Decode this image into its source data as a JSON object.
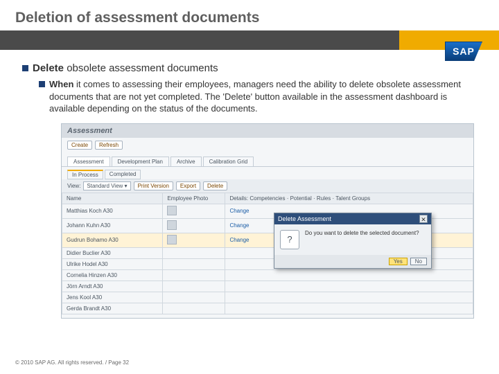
{
  "slide": {
    "title": "Deletion of assessment documents"
  },
  "logo": {
    "text": "SAP"
  },
  "content": {
    "heading_bold": "Delete",
    "heading_rest": " obsolete assessment documents",
    "sub_bold": "When",
    "sub_rest": " it comes to assessing their employees, managers need the ability to delete obsolete assessment documents that are not yet completed. The 'Delete' button available in the assessment dashboard is available depending on the status of the documents."
  },
  "screenshot": {
    "header": "Assessment",
    "toolbar": {
      "btn_create": "Create",
      "btn_refresh": "Refresh"
    },
    "tabs": [
      "Assessment",
      "Development Plan",
      "Archive",
      "Calibration Grid"
    ],
    "subtabs": [
      "In Process",
      "Completed"
    ],
    "view": {
      "label": "View:",
      "value": "Standard View",
      "print": "Print Version",
      "export": "Export",
      "delete": "Delete"
    },
    "columns": [
      "Name",
      "Employee Photo",
      "Details: Competencies · Potential · Rules · Talent Groups"
    ],
    "rows": [
      {
        "name": "Matthias Koch A30",
        "action": "Change",
        "photo": true
      },
      {
        "name": "Johann Kuhn A30",
        "action": "Change",
        "photo": true
      },
      {
        "name": "Gudrun Bohamo A30",
        "action": "Change",
        "photo": true,
        "hl": true
      },
      {
        "name": "Didier Buclier A30",
        "action": "",
        "photo": false
      },
      {
        "name": "Ulrike Hodel A30",
        "action": "",
        "photo": false
      },
      {
        "name": "Cornelia Hinzen A30",
        "action": "",
        "photo": false
      },
      {
        "name": "Jörn Arndt A30",
        "action": "",
        "photo": false
      },
      {
        "name": "Jens Kool A30",
        "action": "",
        "photo": false
      },
      {
        "name": "Gerda Brandt A30",
        "action": "",
        "photo": false
      }
    ]
  },
  "dialog": {
    "title": "Delete Assessment",
    "message": "Do you want to delete the selected document?",
    "yes": "Yes",
    "no": "No"
  },
  "footer": "© 2010 SAP AG. All rights reserved. / Page 32"
}
